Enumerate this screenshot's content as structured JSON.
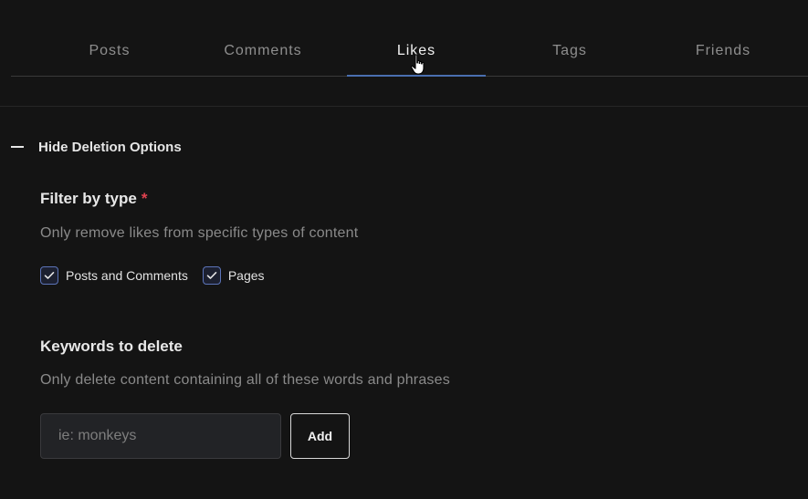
{
  "tabs": [
    {
      "label": "Posts",
      "active": false
    },
    {
      "label": "Comments",
      "active": false
    },
    {
      "label": "Likes",
      "active": true
    },
    {
      "label": "Tags",
      "active": false
    },
    {
      "label": "Friends",
      "active": false
    }
  ],
  "deletion_toggle": {
    "label": "Hide Deletion Options",
    "icon": "minus-icon"
  },
  "filter_section": {
    "title": "Filter by type",
    "required_marker": "*",
    "description": "Only remove likes from specific types of content",
    "options": [
      {
        "label": "Posts and Comments",
        "checked": true
      },
      {
        "label": "Pages",
        "checked": true
      }
    ]
  },
  "keywords_section": {
    "title": "Keywords to delete",
    "description": "Only delete content containing all of these words and phrases",
    "input_placeholder": "ie: monkeys",
    "input_value": "",
    "add_label": "Add"
  },
  "colors": {
    "background": "#141414",
    "accent": "#4a6fb0",
    "required": "#e0424f",
    "muted_text": "#8a8a8a"
  }
}
